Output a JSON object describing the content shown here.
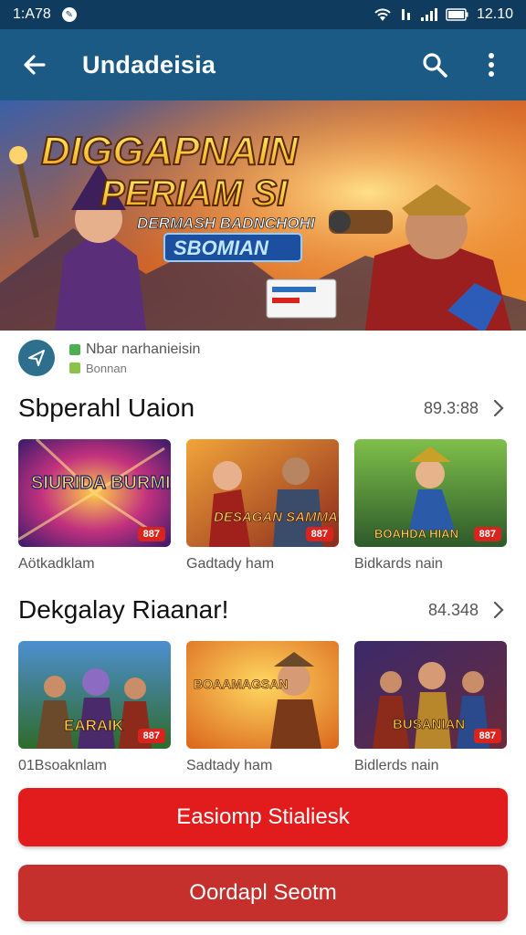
{
  "status_bar": {
    "time": "1:A78",
    "clock": "12.10",
    "icons": [
      "app-notification-icon",
      "wifi-icon",
      "signal-icon",
      "battery-icon"
    ]
  },
  "app_bar": {
    "title": "Undadeisia",
    "back_icon": "arrow-left-icon",
    "search_icon": "search-icon",
    "more_icon": "more-vertical-icon"
  },
  "banner": {
    "headline_1": "DIGGAPNAIN",
    "headline_2": "PERIAM SI",
    "subtitle": "DERMASH BADNCHOHI",
    "tag": "SBOMIAN"
  },
  "info": {
    "title": "Nbar narhanieisin",
    "subtitle": "Bonnan"
  },
  "sections": [
    {
      "title": "Sbperahl Uaion",
      "count": "89.3:88",
      "cards": [
        {
          "art_text": "SIURIDA BURMIAS",
          "badge": "887",
          "caption": "Aötkadklam"
        },
        {
          "art_text": "DESAGAN SAMMAIH",
          "badge": "887",
          "caption": "Gadtady ham"
        },
        {
          "art_text": "BOAHDA HIAN",
          "badge": "887",
          "caption": "Bidkards nain"
        }
      ]
    },
    {
      "title": "Dekgalay Riaanar!",
      "count": "84.348",
      "cards": [
        {
          "art_text": "EARAIK",
          "badge": "887",
          "caption": "01Bsoaknlam"
        },
        {
          "art_text": "BOAAMAGSAN",
          "badge": "",
          "caption": "Sadtady ham"
        },
        {
          "art_text": "BUSANIAN",
          "badge": "887",
          "caption": "Bidlerds nain"
        }
      ]
    }
  ],
  "buttons": {
    "primary": "Easiomp Stialiesk",
    "secondary": "Oordapl Seotm"
  },
  "colors": {
    "status_bar": "#0e3b5e",
    "app_bar": "#1a5a85",
    "primary_button": "#e21c1c",
    "secondary_button": "#c6302c",
    "badge": "#d9241e"
  }
}
